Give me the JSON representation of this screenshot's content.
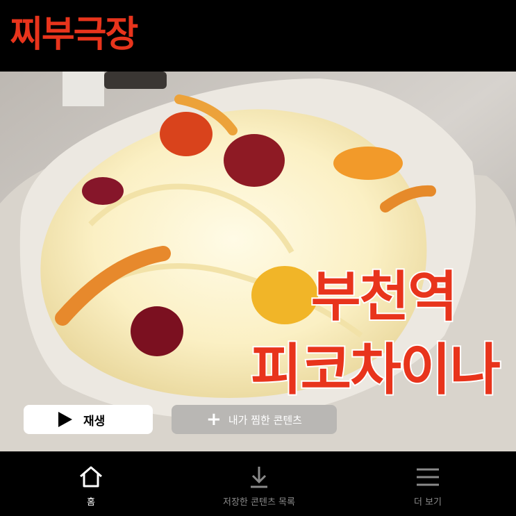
{
  "header": {
    "logo": "찌부극장"
  },
  "hero": {
    "title_line1": "부천역",
    "title_line2": "피코차이나",
    "play_label": "재생",
    "my_list_label": "내가 찜한 콘텐츠"
  },
  "nav": {
    "home_label": "홈",
    "downloads_label": "저장한 콘텐츠 목록",
    "more_label": "더 보기"
  },
  "colors": {
    "accent": "#e8341c",
    "background": "#000000"
  },
  "icons": {
    "play": "play-icon",
    "plus": "plus-icon",
    "home": "home-icon",
    "download": "download-icon",
    "menu": "menu-icon"
  }
}
